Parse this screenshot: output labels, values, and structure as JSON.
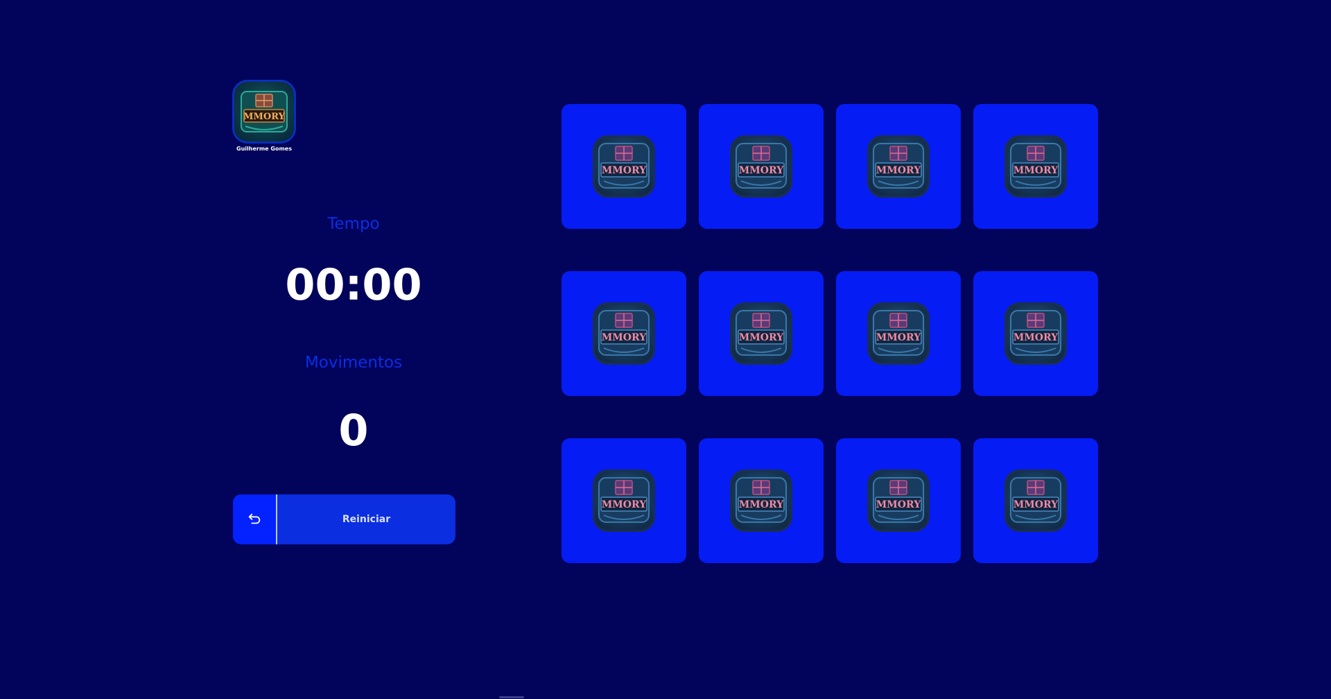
{
  "logo": {
    "text": "MMORY",
    "author": "Guilherme Gomes",
    "icon": "treasure-chest-icon"
  },
  "stats": {
    "time_label": "Tempo",
    "time_value": "00:00",
    "moves_label": "Movimentos",
    "moves_value": "0"
  },
  "restart": {
    "label": "Reiniciar",
    "icon": "undo-arrow-icon"
  },
  "cards": [
    {
      "emblem_text": "MMORY"
    },
    {
      "emblem_text": "MMORY"
    },
    {
      "emblem_text": "MMORY"
    },
    {
      "emblem_text": "MMORY"
    },
    {
      "emblem_text": "MMORY"
    },
    {
      "emblem_text": "MMORY"
    },
    {
      "emblem_text": "MMORY"
    },
    {
      "emblem_text": "MMORY"
    },
    {
      "emblem_text": "MMORY"
    },
    {
      "emblem_text": "MMORY"
    },
    {
      "emblem_text": "MMORY"
    },
    {
      "emblem_text": "MMORY"
    }
  ],
  "colors": {
    "background": "#02035a",
    "card": "#051cf5",
    "label": "#0a2dea",
    "button": "#0a2ee0"
  }
}
